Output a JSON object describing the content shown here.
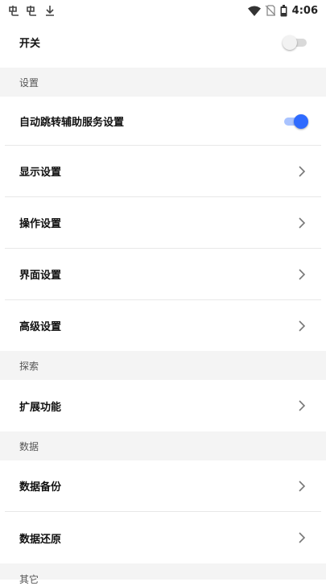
{
  "status_bar": {
    "time": "4:06",
    "notification_icons": [
      "notification-app-icon",
      "notification-app-icon",
      "download-icon"
    ],
    "system_icons": [
      "wifi-icon",
      "no-sim-icon",
      "battery-icon"
    ]
  },
  "toggle_main": {
    "label": "开关",
    "on": false
  },
  "sections": {
    "settings": "设置",
    "explore": "探索",
    "data": "数据",
    "other": "其它"
  },
  "items": {
    "auto_jump": {
      "label": "自动跳转辅助服务设置",
      "on": true
    },
    "display": "显示设置",
    "operation": "操作设置",
    "interface": "界面设置",
    "advanced": "高级设置",
    "extensions": "扩展功能",
    "backup": "数据备份",
    "restore": "数据还原"
  },
  "colors": {
    "accent": "#2f6bff",
    "accent_track": "#a9c3ff",
    "section_bg": "#f4f4f4",
    "divider": "#e8e8e8"
  }
}
